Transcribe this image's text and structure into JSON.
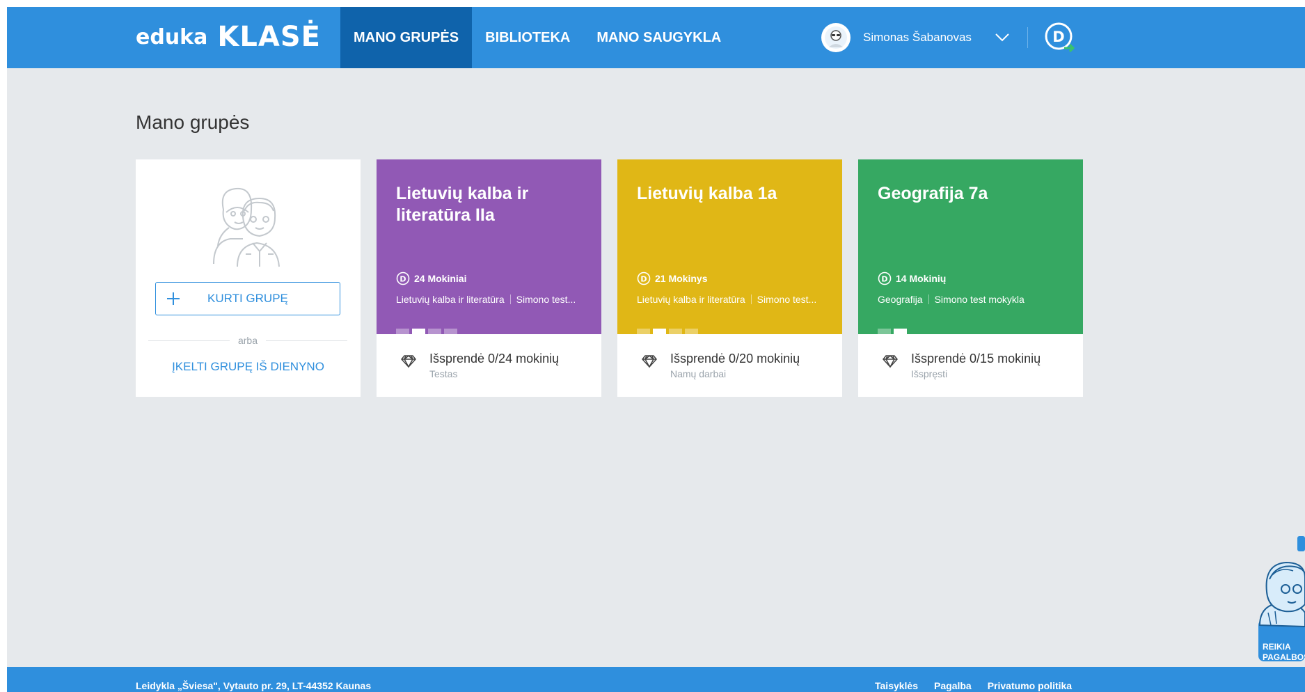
{
  "brand": {
    "part1": "eduka",
    "part2": "KLASĖ"
  },
  "nav": [
    {
      "label": "MANO GRUPĖS",
      "active": true
    },
    {
      "label": "BIBLIOTEKA",
      "active": false
    },
    {
      "label": "MANO SAUGYKLA",
      "active": false
    }
  ],
  "user": {
    "name": "Simonas Šabanovas"
  },
  "page": {
    "title": "Mano grupės"
  },
  "create": {
    "button": "KURTI GRUPĘ",
    "or": "arba",
    "import": "ĮKELTI GRUPĘ IŠ DIENYNO"
  },
  "groups": [
    {
      "title": "Lietuvių kalba ir literatūra IIa",
      "count": "24 Mokiniai",
      "subject": "Lietuvių kalba ir literatūra",
      "school": "Simono test...",
      "color": "#9159b5",
      "solved": "Išsprendė 0/24 mokinių",
      "task": "Testas"
    },
    {
      "title": "Lietuvių kalba 1a",
      "count": "21 Mokinys",
      "subject": "Lietuvių kalba ir literatūra",
      "school": "Simono test...",
      "color": "#e0b716",
      "solved": "Išsprendė 0/20 mokinių",
      "task": "Namų darbai"
    },
    {
      "title": "Geografija 7a",
      "count": "14 Mokinių",
      "subject": "Geografija",
      "school": "Simono test mokykla",
      "color": "#36a862",
      "solved": "Išsprendė 0/15 mokinių",
      "task": "Išspręsti"
    }
  ],
  "footer": {
    "address": "Leidykla „Šviesa\", Vytauto pr. 29, LT-44352 Kaunas",
    "links": [
      "Taisyklės",
      "Pagalba",
      "Privatumo politika"
    ]
  },
  "help": {
    "line1": "REIKIA",
    "line2": "PAGALBOS"
  }
}
